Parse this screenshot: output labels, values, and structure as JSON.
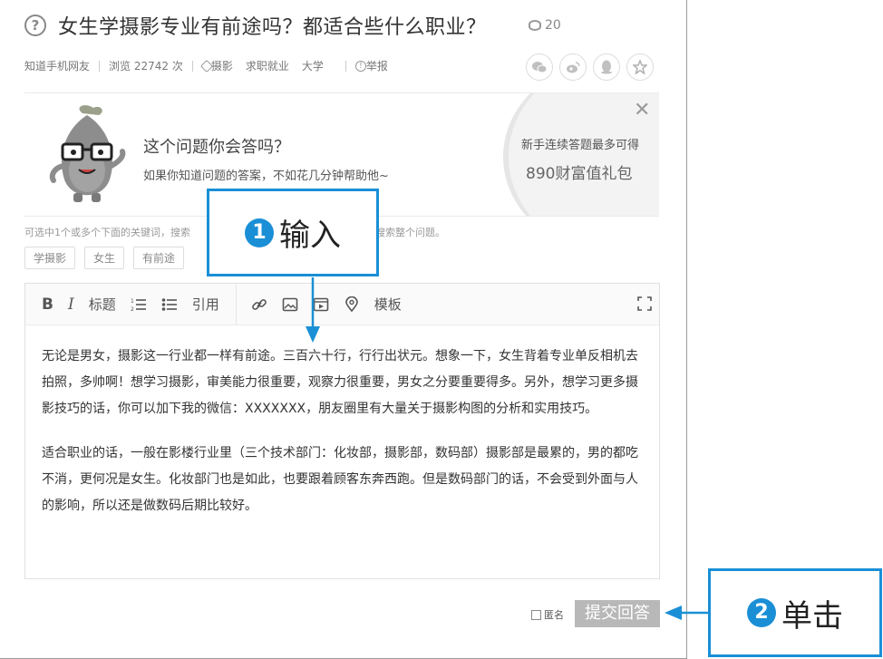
{
  "question": {
    "title": "女生学摄影专业有前途吗？都适合些什么职业？",
    "coins": "20",
    "author": "知道手机网友",
    "views": "浏览 22742 次",
    "tags": [
      "摄影",
      "求职就业",
      "大学"
    ],
    "report": "举报"
  },
  "share_icons": [
    "wechat-icon",
    "weibo-icon",
    "qq-icon",
    "star-icon"
  ],
  "promo": {
    "question": "这个问题你会答吗？",
    "subtitle": "如果你知道问题的答案，不如花几分钟帮助他~",
    "reward_line1": "新手连续答题最多可得",
    "reward_line2": "890财富值礼包"
  },
  "keywords": {
    "hint_left": "可选中1个或多个下面的关键词，搜索",
    "hint_right": "搜索整个问题。",
    "tags": [
      "学摄影",
      "女生",
      "有前途"
    ]
  },
  "toolbar": {
    "bold": "B",
    "italic": "I",
    "heading": "标题",
    "quote": "引用",
    "template": "模板"
  },
  "answer": {
    "paragraph1": "无论是男女，摄影这一行业都一样有前途。三百六十行，行行出状元。想象一下，女生背着专业单反相机去拍照，多帅啊！想学习摄影，审美能力很重要，观察力很重要，男女之分要重要得多。另外，想学习更多摄影技巧的话，你可以加下我的微信：XXXXXXX，朋友圈里有大量关于摄影构图的分析和实用技巧。",
    "paragraph2": "适合职业的话，一般在影楼行业里（三个技术部门：化妆部，摄影部，数码部）摄影部是最累的，男的都吃不消，更何况是女生。化妆部门也是如此，也要跟着顾客东奔西跑。但是数码部门的话，不会受到外面与人的影响，所以还是做数码后期比较好。"
  },
  "submit": {
    "anonymous_label": "匿名",
    "button_label": "提交回答"
  },
  "callouts": {
    "step1_number": "1",
    "step1_text": "输入",
    "step2_number": "2",
    "step2_text": "单击"
  },
  "colors": {
    "callout_blue": "#1a8fd6",
    "submit_gray": "#b8b8b8"
  }
}
